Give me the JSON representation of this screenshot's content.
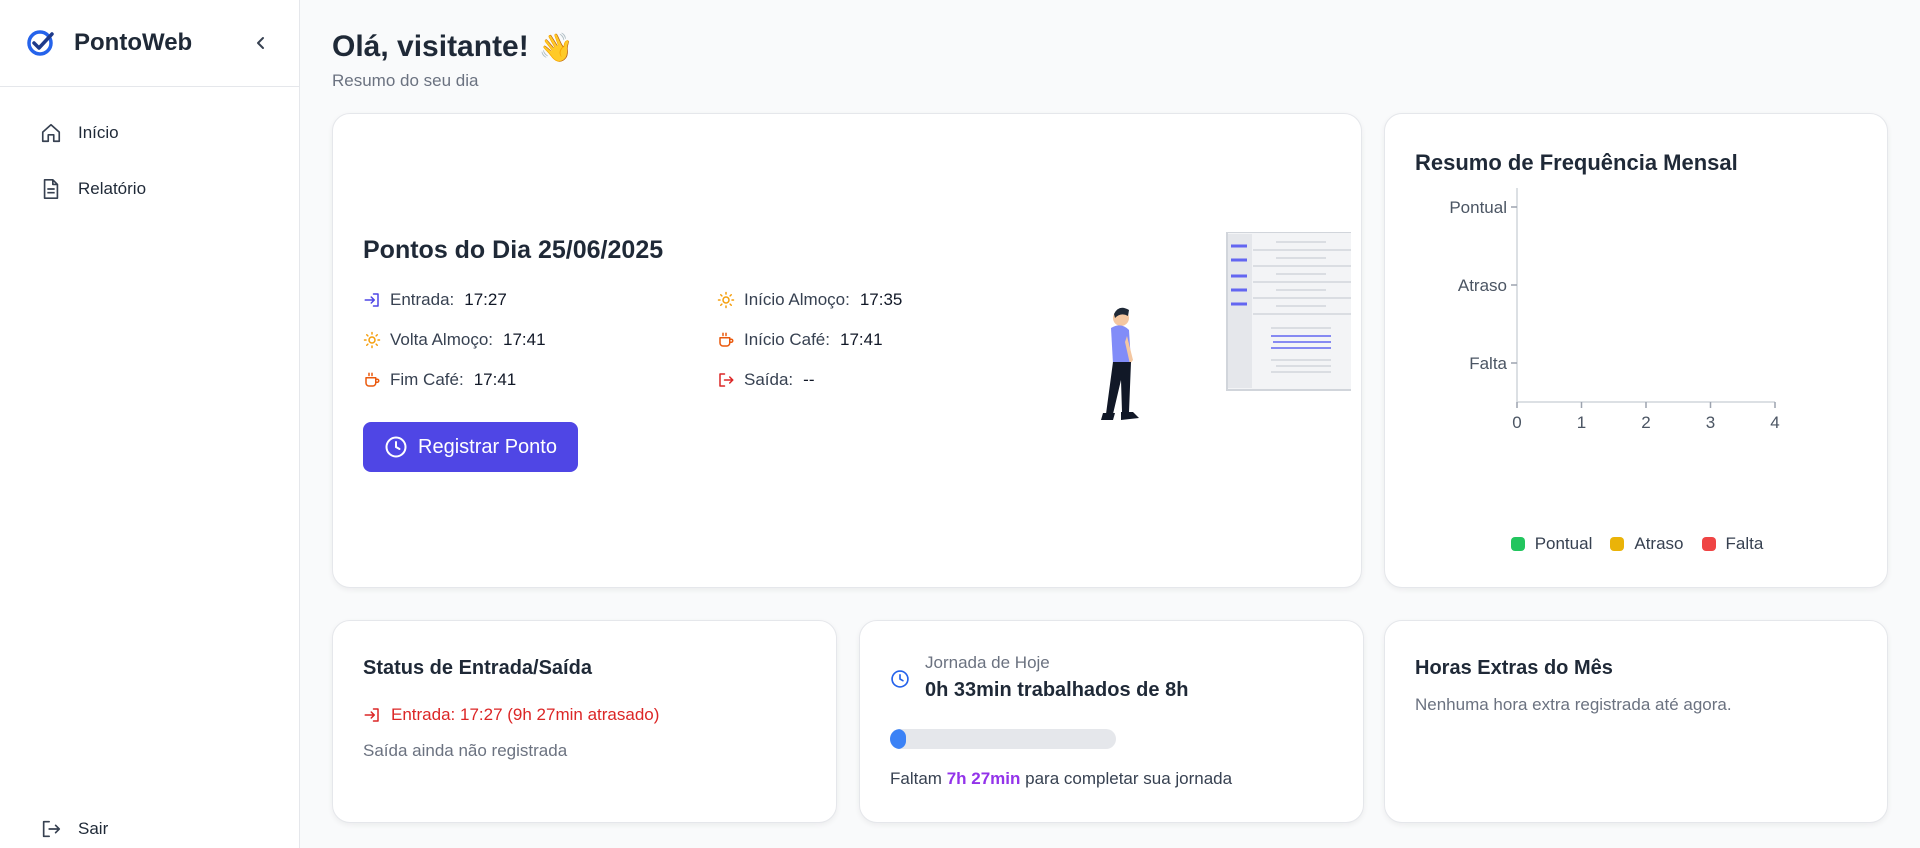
{
  "app": {
    "name": "PontoWeb",
    "accent": "#4f46e5"
  },
  "sidebar": {
    "items": [
      {
        "label": "Início",
        "icon": "home-icon"
      },
      {
        "label": "Relatório",
        "icon": "document-icon"
      }
    ],
    "logout_label": "Sair"
  },
  "header": {
    "greeting": "Olá, visitante!",
    "wave": "👋",
    "subtitle": "Resumo do seu dia"
  },
  "pontos": {
    "title": "Pontos do Dia 25/06/2025",
    "entries": [
      {
        "label": "Entrada:",
        "value": "17:27",
        "icon": "login-icon"
      },
      {
        "label": "Início Almoço:",
        "value": "17:35",
        "icon": "sun-icon"
      },
      {
        "label": "Volta Almoço:",
        "value": "17:41",
        "icon": "sun-icon"
      },
      {
        "label": "Início Café:",
        "value": "17:41",
        "icon": "coffee-icon"
      },
      {
        "label": "Fim Café:",
        "value": "17:41",
        "icon": "coffee-icon"
      },
      {
        "label": "Saída:",
        "value": "--",
        "icon": "logout-icon"
      }
    ],
    "button_label": "Registrar Ponto"
  },
  "chart_data": {
    "type": "bar",
    "orientation": "horizontal",
    "title": "Resumo de Frequência Mensal",
    "categories": [
      "Pontual",
      "Atraso",
      "Falta"
    ],
    "values": [
      0,
      0,
      0
    ],
    "xlim": [
      0,
      4
    ],
    "xticks": [
      "0",
      "1",
      "2",
      "3",
      "4"
    ],
    "legend": [
      {
        "name": "Pontual",
        "color": "#22c55e"
      },
      {
        "name": "Atraso",
        "color": "#eab308"
      },
      {
        "name": "Falta",
        "color": "#ef4444"
      }
    ],
    "legend_position": "bottom",
    "grid": false
  },
  "status": {
    "title": "Status de Entrada/Saída",
    "entry_text": "Entrada: 17:27 (9h 27min atrasado)",
    "exit_text": "Saída ainda não registrada"
  },
  "jornada": {
    "label": "Jornada de Hoje",
    "value": "0h 33min trabalhados de 8h",
    "progress_fraction": 0.069,
    "remaining_prefix": "Faltam",
    "remaining_value": "7h 27min",
    "remaining_suffix": "para completar sua jornada"
  },
  "extras": {
    "title": "Horas Extras do Mês",
    "text": "Nenhuma hora extra registrada até agora."
  }
}
